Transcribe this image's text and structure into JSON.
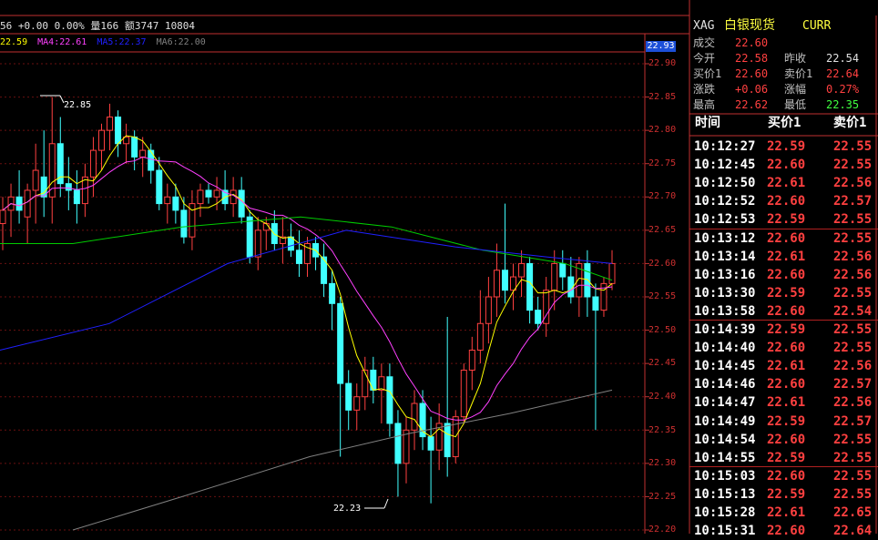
{
  "top_info": "56 +0.00 0.00% 量166 额3747 10804",
  "ma_legend": [
    {
      "text": "22.59",
      "color": "#ffff00"
    },
    {
      "text": "MA4:22.61",
      "color": "#ff40ff"
    },
    {
      "text": "MA5:22.37",
      "color": "#2020ff"
    },
    {
      "text": "MA6:22.00",
      "color": "#808080"
    }
  ],
  "current_price_tag": "22.93",
  "y_axis_labels": [
    "22.90",
    "22.85",
    "22.80",
    "22.75",
    "22.70",
    "22.65",
    "22.60",
    "22.55",
    "22.50",
    "22.45",
    "22.40",
    "22.35",
    "22.30",
    "22.25",
    "22.20"
  ],
  "annotations": {
    "high": "22.85",
    "low": "22.23"
  },
  "colors": {
    "up": "#ff4040",
    "down": "#40ffff",
    "ma_short": "#ffff00",
    "ma_mid": "#ff40ff",
    "ma_green": "#00cc00",
    "ma_blue": "#2020ff",
    "ma_gray": "#808080"
  },
  "quote_panel": {
    "symbol": "XAG",
    "name": "白银现货",
    "curr": "CURR",
    "last_label": "成交",
    "last": "22.60",
    "open_label": "今开",
    "open": "22.58",
    "prev_label": "昨收",
    "prev": "22.54",
    "bid1_label": "买价1",
    "bid1": "22.60",
    "ask1_label": "卖价1",
    "ask1": "22.64",
    "change_label": "涨跌",
    "change": "+0.06",
    "pct_label": "涨幅",
    "pct": "0.27%",
    "high_label": "最高",
    "high": "22.62",
    "low_label": "最低",
    "low": "22.35"
  },
  "trade_header": {
    "time": "时间",
    "bid": "买价1",
    "ask": "卖价1"
  },
  "trades": [
    {
      "time": "10:12:27",
      "bid": "22.59",
      "ask": "22.55"
    },
    {
      "time": "10:12:45",
      "bid": "22.60",
      "ask": "22.55"
    },
    {
      "time": "10:12:50",
      "bid": "22.61",
      "ask": "22.56"
    },
    {
      "time": "10:12:52",
      "bid": "22.60",
      "ask": "22.57"
    },
    {
      "time": "10:12:53",
      "bid": "22.59",
      "ask": "22.55"
    },
    {
      "time": "10:13:12",
      "bid": "22.60",
      "ask": "22.55"
    },
    {
      "time": "10:13:14",
      "bid": "22.61",
      "ask": "22.56"
    },
    {
      "time": "10:13:16",
      "bid": "22.60",
      "ask": "22.56"
    },
    {
      "time": "10:13:30",
      "bid": "22.59",
      "ask": "22.55"
    },
    {
      "time": "10:13:58",
      "bid": "22.60",
      "ask": "22.54"
    },
    {
      "time": "10:14:39",
      "bid": "22.59",
      "ask": "22.55"
    },
    {
      "time": "10:14:40",
      "bid": "22.60",
      "ask": "22.55"
    },
    {
      "time": "10:14:45",
      "bid": "22.61",
      "ask": "22.56"
    },
    {
      "time": "10:14:46",
      "bid": "22.60",
      "ask": "22.57"
    },
    {
      "time": "10:14:47",
      "bid": "22.61",
      "ask": "22.56"
    },
    {
      "time": "10:14:49",
      "bid": "22.59",
      "ask": "22.57"
    },
    {
      "time": "10:14:54",
      "bid": "22.60",
      "ask": "22.55"
    },
    {
      "time": "10:14:55",
      "bid": "22.59",
      "ask": "22.55"
    },
    {
      "time": "10:15:03",
      "bid": "22.60",
      "ask": "22.55"
    },
    {
      "time": "10:15:13",
      "bid": "22.59",
      "ask": "22.55"
    },
    {
      "time": "10:15:28",
      "bid": "22.61",
      "ask": "22.65"
    },
    {
      "time": "10:15:31",
      "bid": "22.60",
      "ask": "22.64"
    }
  ],
  "chart_data": {
    "type": "candlestick",
    "ylim": [
      22.2,
      22.9
    ],
    "candles_ohlc": [
      [
        22.66,
        22.7,
        22.62,
        22.68
      ],
      [
        22.68,
        22.72,
        22.64,
        22.7
      ],
      [
        22.7,
        22.74,
        22.66,
        22.68
      ],
      [
        22.67,
        22.72,
        22.63,
        22.71
      ],
      [
        22.71,
        22.78,
        22.66,
        22.74
      ],
      [
        22.73,
        22.8,
        22.67,
        22.7
      ],
      [
        22.7,
        22.85,
        22.66,
        22.78
      ],
      [
        22.78,
        22.82,
        22.7,
        22.72
      ],
      [
        22.72,
        22.76,
        22.68,
        22.71
      ],
      [
        22.71,
        22.74,
        22.66,
        22.69
      ],
      [
        22.69,
        22.75,
        22.67,
        22.73
      ],
      [
        22.73,
        22.79,
        22.7,
        22.77
      ],
      [
        22.77,
        22.81,
        22.74,
        22.8
      ],
      [
        22.8,
        22.84,
        22.77,
        22.82
      ],
      [
        22.82,
        22.83,
        22.76,
        22.78
      ],
      [
        22.78,
        22.81,
        22.75,
        22.79
      ],
      [
        22.79,
        22.8,
        22.74,
        22.76
      ],
      [
        22.76,
        22.79,
        22.73,
        22.77
      ],
      [
        22.77,
        22.78,
        22.72,
        22.74
      ],
      [
        22.74,
        22.76,
        22.68,
        22.69
      ],
      [
        22.69,
        22.72,
        22.66,
        22.7
      ],
      [
        22.7,
        22.72,
        22.66,
        22.68
      ],
      [
        22.68,
        22.7,
        22.63,
        22.64
      ],
      [
        22.64,
        22.71,
        22.62,
        22.69
      ],
      [
        22.69,
        22.72,
        22.67,
        22.71
      ],
      [
        22.71,
        22.72,
        22.69,
        22.7
      ],
      [
        22.7,
        22.73,
        22.68,
        22.71
      ],
      [
        22.71,
        22.74,
        22.68,
        22.69
      ],
      [
        22.69,
        22.73,
        22.67,
        22.71
      ],
      [
        22.71,
        22.73,
        22.66,
        22.67
      ],
      [
        22.67,
        22.68,
        22.6,
        22.61
      ],
      [
        22.61,
        22.67,
        22.59,
        22.65
      ],
      [
        22.65,
        22.67,
        22.62,
        22.66
      ],
      [
        22.66,
        22.68,
        22.62,
        22.63
      ],
      [
        22.63,
        22.67,
        22.6,
        22.64
      ],
      [
        22.64,
        22.66,
        22.61,
        22.62
      ],
      [
        22.62,
        22.65,
        22.58,
        22.6
      ],
      [
        22.6,
        22.64,
        22.58,
        22.63
      ],
      [
        22.63,
        22.64,
        22.59,
        22.61
      ],
      [
        22.61,
        22.63,
        22.55,
        22.57
      ],
      [
        22.57,
        22.59,
        22.5,
        22.54
      ],
      [
        22.54,
        22.55,
        22.31,
        22.42
      ],
      [
        22.42,
        22.44,
        22.35,
        22.38
      ],
      [
        22.38,
        22.42,
        22.35,
        22.4
      ],
      [
        22.4,
        22.46,
        22.38,
        22.44
      ],
      [
        22.44,
        22.46,
        22.39,
        22.41
      ],
      [
        22.41,
        22.45,
        22.36,
        22.43
      ],
      [
        22.43,
        22.45,
        22.34,
        22.36
      ],
      [
        22.36,
        22.38,
        22.25,
        22.3
      ],
      [
        22.3,
        22.37,
        22.27,
        22.35
      ],
      [
        22.35,
        22.41,
        22.32,
        22.39
      ],
      [
        22.39,
        22.41,
        22.32,
        22.34
      ],
      [
        22.34,
        22.37,
        22.24,
        22.32
      ],
      [
        22.32,
        22.39,
        22.29,
        22.36
      ],
      [
        22.36,
        22.52,
        22.28,
        22.31
      ],
      [
        22.31,
        22.38,
        22.3,
        22.37
      ],
      [
        22.37,
        22.45,
        22.36,
        22.44
      ],
      [
        22.44,
        22.49,
        22.41,
        22.47
      ],
      [
        22.47,
        22.56,
        22.45,
        22.51
      ],
      [
        22.51,
        22.58,
        22.48,
        22.55
      ],
      [
        22.55,
        22.63,
        22.52,
        22.59
      ],
      [
        22.59,
        22.69,
        22.54,
        22.56
      ],
      [
        22.56,
        22.6,
        22.53,
        22.58
      ],
      [
        22.58,
        22.62,
        22.55,
        22.6
      ],
      [
        22.6,
        22.61,
        22.51,
        22.53
      ],
      [
        22.53,
        22.55,
        22.5,
        22.51
      ],
      [
        22.51,
        22.58,
        22.49,
        22.56
      ],
      [
        22.56,
        22.62,
        22.53,
        22.6
      ],
      [
        22.6,
        22.62,
        22.56,
        22.58
      ],
      [
        22.58,
        22.61,
        22.54,
        22.55
      ],
      [
        22.55,
        22.61,
        22.52,
        22.6
      ],
      [
        22.6,
        22.62,
        22.52,
        22.55
      ],
      [
        22.55,
        22.57,
        22.35,
        22.53
      ],
      [
        22.53,
        22.58,
        22.52,
        22.57
      ],
      [
        22.57,
        22.62,
        22.56,
        22.6
      ]
    ]
  }
}
